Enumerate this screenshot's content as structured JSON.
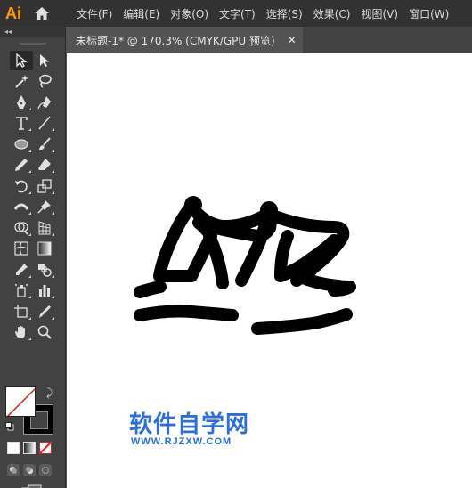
{
  "app": {
    "logo": "Ai"
  },
  "menu": [
    {
      "label": "文件(F)"
    },
    {
      "label": "编辑(E)"
    },
    {
      "label": "对象(O)"
    },
    {
      "label": "文字(T)"
    },
    {
      "label": "选择(S)"
    },
    {
      "label": "效果(C)"
    },
    {
      "label": "视图(V)"
    },
    {
      "label": "窗口(W)"
    }
  ],
  "toolbar": {
    "collapse_label": "◂◂",
    "rows": [
      [
        "selection-tool",
        "direct-selection-tool"
      ],
      [
        "magic-wand-tool",
        "lasso-tool"
      ],
      [
        "pen-tool",
        "curvature-tool"
      ],
      [
        "type-tool",
        "line-segment-tool"
      ],
      [
        "ellipse-tool",
        "paintbrush-tool"
      ],
      [
        "pencil-tool",
        "eraser-tool"
      ],
      [
        "rotate-tool",
        "scale-tool"
      ],
      [
        "width-tool",
        "puppet-warp-tool"
      ],
      [
        "shape-builder-tool",
        "perspective-grid-tool"
      ],
      [
        "mesh-tool",
        "gradient-tool"
      ],
      [
        "eyedropper-tool",
        "blend-tool"
      ],
      [
        "symbol-sprayer-tool",
        "column-graph-tool"
      ],
      [
        "artboard-tool",
        "slice-tool"
      ],
      [
        "hand-tool",
        "zoom-tool"
      ]
    ]
  },
  "document": {
    "tab_label": "未标题-1* @ 170.3% (CMYK/GPU 预览)",
    "close_label": "✕"
  },
  "watermark": {
    "text": "软件自学网",
    "url": "WWW.RJZXW.COM"
  },
  "colors": {
    "accent_logo": "#ff9a00",
    "watermark": "#2a6fe0",
    "canvas": "#ffffff",
    "artwork_stroke": "#000000"
  }
}
